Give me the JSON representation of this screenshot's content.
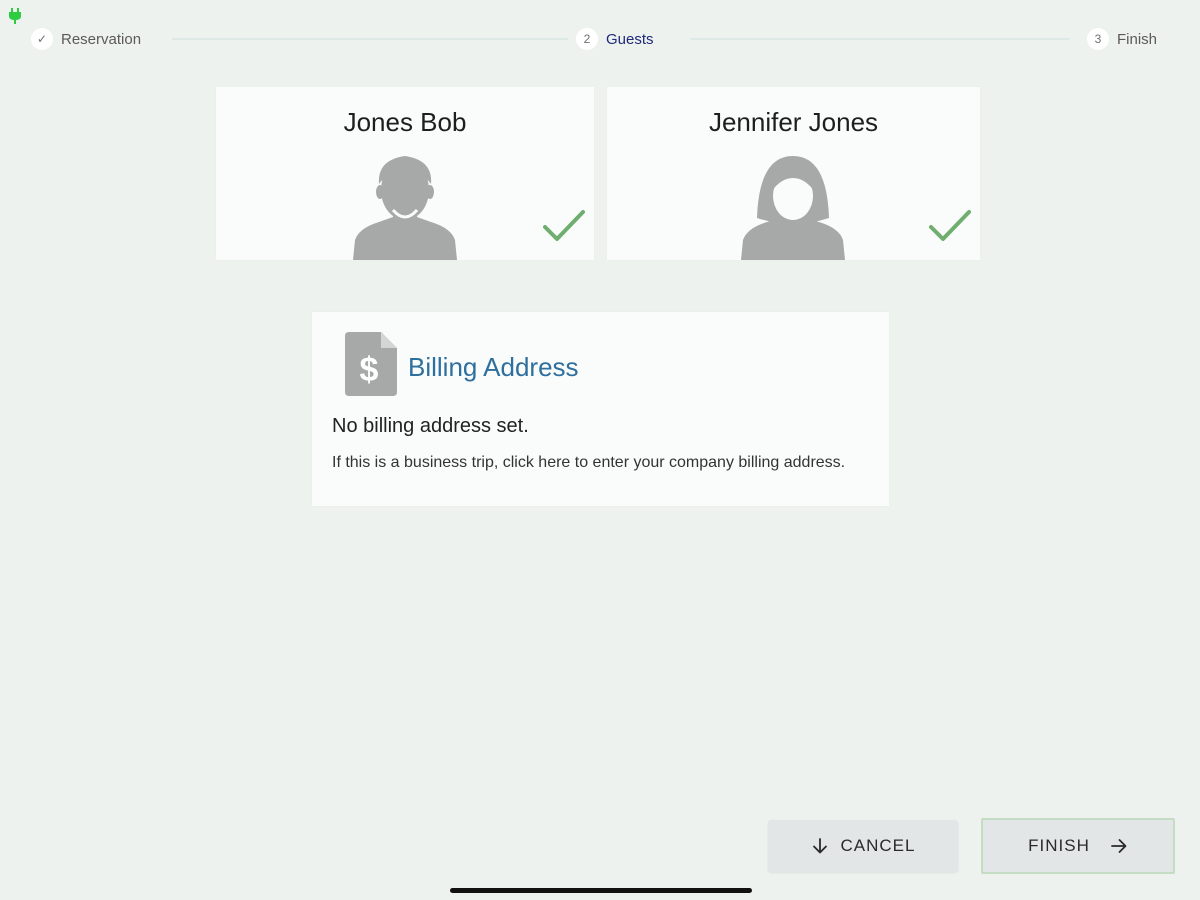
{
  "stepper": {
    "steps": [
      {
        "number": "✓",
        "label": "Reservation",
        "state": "done"
      },
      {
        "number": "2",
        "label": "Guests",
        "state": "active"
      },
      {
        "number": "3",
        "label": "Finish",
        "state": "upcoming"
      }
    ]
  },
  "guests": [
    {
      "name": "Jones Bob",
      "avatar": "male-avatar-icon",
      "checked": true
    },
    {
      "name": "Jennifer Jones",
      "avatar": "female-avatar-icon",
      "checked": true
    }
  ],
  "billing": {
    "icon": "invoice-dollar-icon",
    "title": "Billing Address",
    "status": "No billing address set.",
    "hint": "If this is a business trip, click here to enter your company billing address."
  },
  "actions": {
    "cancel_label": "CANCEL",
    "finish_label": "FINISH"
  },
  "colors": {
    "background": "#eef2ef",
    "active_step": "#1f2a7a",
    "billing_title": "#2e6f9e",
    "checkmark": "#6fae6f",
    "avatar": "#a7a9a9",
    "status_plug": "#2ecc40"
  }
}
